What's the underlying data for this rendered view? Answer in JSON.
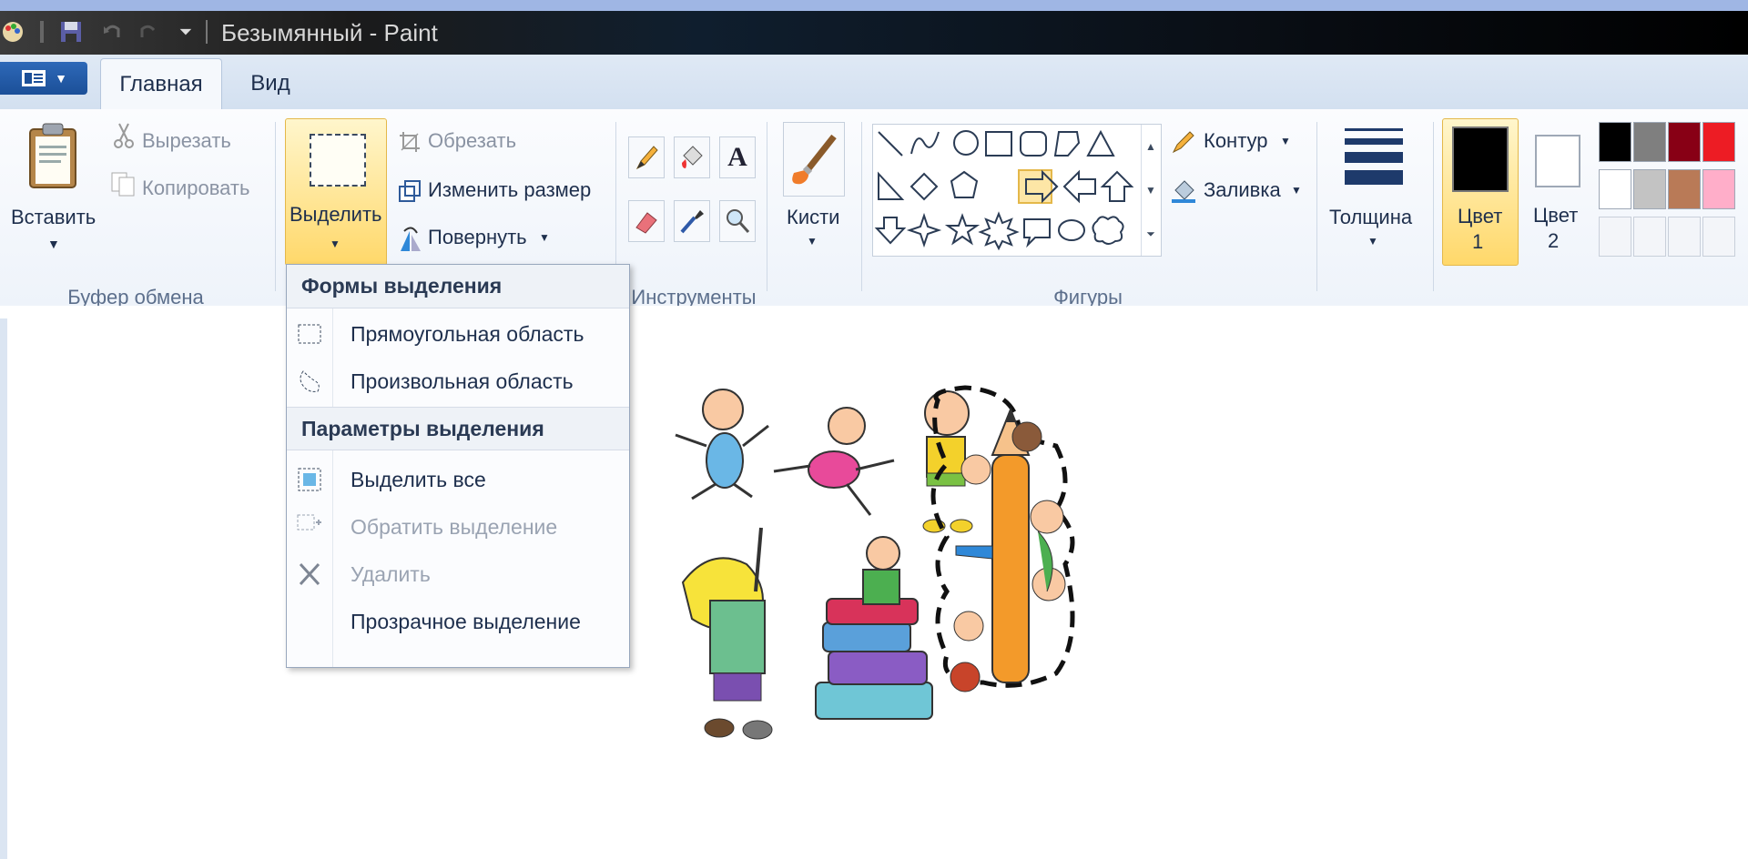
{
  "window": {
    "title": "Безымянный - Paint"
  },
  "tabs": [
    {
      "label": "Главная"
    },
    {
      "label": "Вид"
    }
  ],
  "clipboard": {
    "paste": "Вставить",
    "cut": "Вырезать",
    "copy": "Копировать",
    "group": "Буфер обмена"
  },
  "image": {
    "select": "Выделить",
    "crop": "Обрезать",
    "resize": "Изменить размер",
    "rotate": "Повернуть"
  },
  "tools": {
    "group": "Инструменты"
  },
  "brushes": {
    "label": "Кисти"
  },
  "shapes": {
    "outline": "Контур",
    "fill": "Заливка",
    "group": "Фигуры"
  },
  "size": {
    "label": "Толщина"
  },
  "colors": {
    "color1_line1": "Цвет",
    "color1_line2": "1",
    "color2_line1": "Цвет",
    "color2_line2": "2",
    "palette": [
      "#000000",
      "#7f7f7f",
      "#880015",
      "#ed1c24",
      "#ffffff",
      "#c3c3c3",
      "#b97a57",
      "#ffaec9"
    ]
  },
  "selection_menu": {
    "header_shapes": "Формы выделения",
    "rect": "Прямоугольная область",
    "free": "Произвольная область",
    "header_options": "Параметры выделения",
    "select_all": "Выделить все",
    "invert": "Обратить выделение",
    "delete": "Удалить",
    "transparent": "Прозрачное выделение"
  }
}
